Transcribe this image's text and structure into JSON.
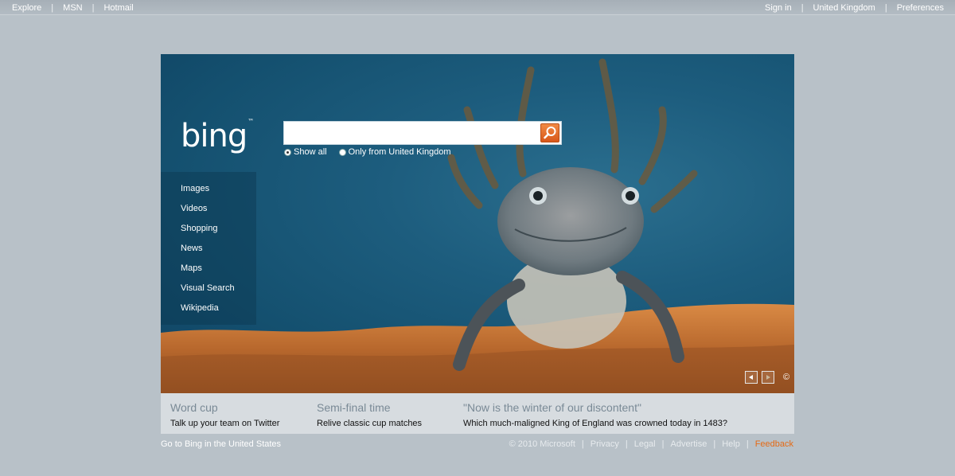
{
  "topbar": {
    "left": [
      "Explore",
      "MSN",
      "Hotmail"
    ],
    "right": [
      "Sign in",
      "United Kingdom",
      "Preferences"
    ]
  },
  "logo": {
    "text": "bing",
    "tm": "™"
  },
  "search": {
    "value": "",
    "placeholder": "",
    "options": [
      {
        "label": "Show all",
        "selected": true
      },
      {
        "label": "Only from United Kingdom",
        "selected": false
      }
    ]
  },
  "sidenav": [
    "Images",
    "Videos",
    "Shopping",
    "News",
    "Maps",
    "Visual Search",
    "Wikipedia"
  ],
  "hero": {
    "copyright_symbol": "©"
  },
  "hotspots": [
    {
      "title": "Word cup",
      "subtitle": "Talk up your team on Twitter"
    },
    {
      "title": "Semi-final time",
      "subtitle": "Relive classic cup matches"
    },
    {
      "title": "\"Now is the winter of our discontent\"",
      "subtitle": "Which much-maligned King of England was crowned today in 1483?"
    }
  ],
  "footer": {
    "left": "Go to Bing in the United States",
    "right": [
      "© 2010 Microsoft",
      "Privacy",
      "Legal",
      "Advertise",
      "Help"
    ],
    "feedback": "Feedback"
  },
  "colors": {
    "accent_orange": "#e56a15",
    "background": "#b8c1c8",
    "hero_blue": "#1d5d7e"
  }
}
